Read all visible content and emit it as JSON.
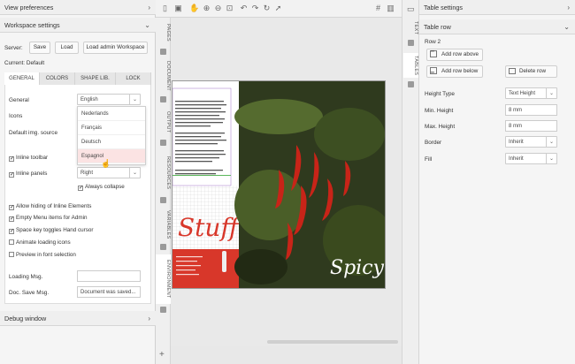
{
  "left": {
    "view_prefs_title": "View preferences",
    "workspace_title": "Workspace settings",
    "server_label": "Server:",
    "save_btn": "Save",
    "load_btn": "Load",
    "load_admin_btn": "Load admin Workspace",
    "current_label": "Current: Default",
    "tabs": [
      "GENERAL",
      "COLORS",
      "SHAPE LIB.",
      "LOCK"
    ],
    "general_label": "General",
    "general_value": "English",
    "icons_label": "Icons",
    "default_img_label": "Default img. source",
    "language_options": [
      "Nederlands",
      "Français",
      "Deutsch",
      "Espagnol"
    ],
    "inline_toolbar": "Inline toolbar",
    "inline_panels": "Inline panels",
    "inline_panels_value": "Right",
    "always_collapse": "Always collapse",
    "options": [
      {
        "label": "Allow hiding of Inline Elements",
        "checked": true
      },
      {
        "label": "Empty Menu items for Admin",
        "checked": true
      },
      {
        "label": "Space key toggles Hand cursor",
        "checked": true
      },
      {
        "label": "Animate loading icons",
        "checked": false
      },
      {
        "label": "Preview in font selection",
        "checked": false
      }
    ],
    "loading_msg_label": "Loading Msg.",
    "doc_save_label": "Doc. Save Msg.",
    "doc_save_value": "Document was saved...",
    "debug_title": "Debug window"
  },
  "vtabs": [
    "PAGES",
    "DOCUMENT",
    "OUTPUT",
    "RESOURCES",
    "VARIABLES",
    "ENVIRONMENT"
  ],
  "rtabs": [
    "TEXT",
    "TABLES"
  ],
  "page_text": {
    "stuff": "Stuff",
    "spicy": "Spicy"
  },
  "right": {
    "title": "Table settings",
    "section": "Table row",
    "row_label": "Row 2",
    "add_above": "Add row above",
    "add_below": "Add row below",
    "delete_row": "Delete row",
    "height_type_label": "Height Type",
    "height_type_value": "Text Height",
    "min_height_label": "Min. Height",
    "min_height_value": "8 mm",
    "max_height_label": "Max. Height",
    "max_height_value": "8 mm",
    "border_label": "Border",
    "border_value": "Inherit",
    "fill_label": "Fill",
    "fill_value": "Inherit"
  },
  "colors": {
    "accent": "#d8372a",
    "pepper": "#c82418"
  }
}
